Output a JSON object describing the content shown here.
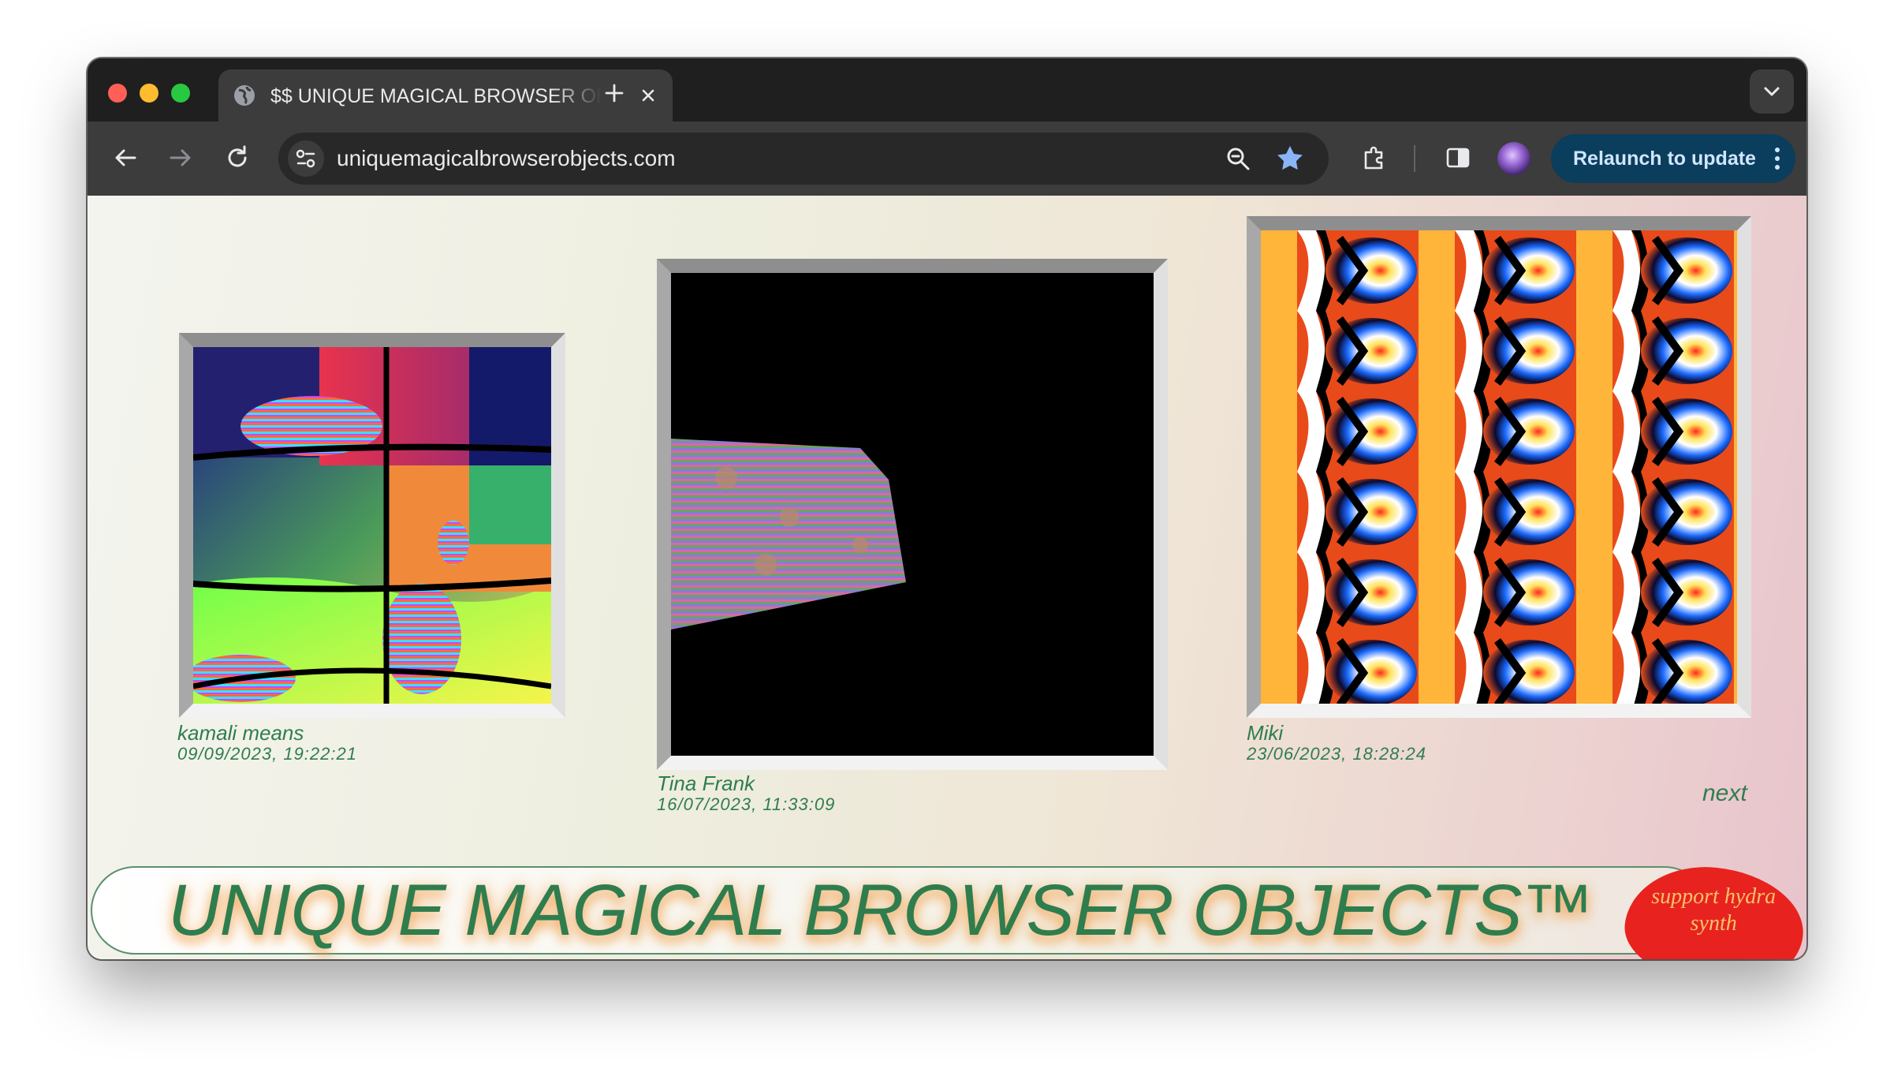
{
  "browser": {
    "tab_title": "$$ UNIQUE MAGICAL BROWSER OBJECTS",
    "url": "uniquemagicalbrowserobjects.com",
    "relaunch_label": "Relaunch to update",
    "accent_color": "#0b3d5c"
  },
  "gallery": {
    "items": [
      {
        "author": "kamali means",
        "date": "09/09/2023, 19:22:21"
      },
      {
        "author": "Tina Frank",
        "date": "16/07/2023, 11:33:09"
      },
      {
        "author": "Miki",
        "date": "23/06/2023, 18:28:24"
      }
    ],
    "next_label": "next",
    "text_color": "#2f7d4e"
  },
  "banner": {
    "title": "UNIQUE MAGICAL BROWSER OBJECTS™",
    "support_label": "support hydra synth",
    "support_color": "#e8221f"
  }
}
